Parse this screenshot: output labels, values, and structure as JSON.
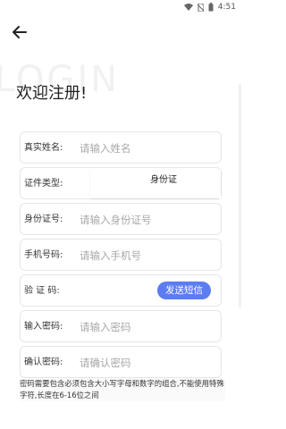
{
  "status_bar": {
    "time": "4:51"
  },
  "watermark": "LOGIN",
  "welcome": "欢迎注册!",
  "form": {
    "name": {
      "label": "真实姓名:",
      "placeholder": "请输入姓名"
    },
    "id_type": {
      "label": "证件类型:",
      "selected": "身份证"
    },
    "id_no": {
      "label": "身份证号:",
      "placeholder": "请输入身份证号"
    },
    "phone": {
      "label": "手机号码:",
      "placeholder": "请输入手机号"
    },
    "code": {
      "label": "验 证 码:",
      "button": "发送短信"
    },
    "password": {
      "label": "输入密码:",
      "placeholder": "请输入密码"
    },
    "confirm": {
      "label": "确认密码:",
      "placeholder": "请确认密码"
    }
  },
  "password_note": "密码需要包含必须包含大小写字母和数字的组合,不能使用特殊字符,长度在6-16位之间",
  "colors": {
    "accent": "#5b7cf2",
    "border": "#e6e6e6",
    "placeholder": "#a8a8a8"
  }
}
